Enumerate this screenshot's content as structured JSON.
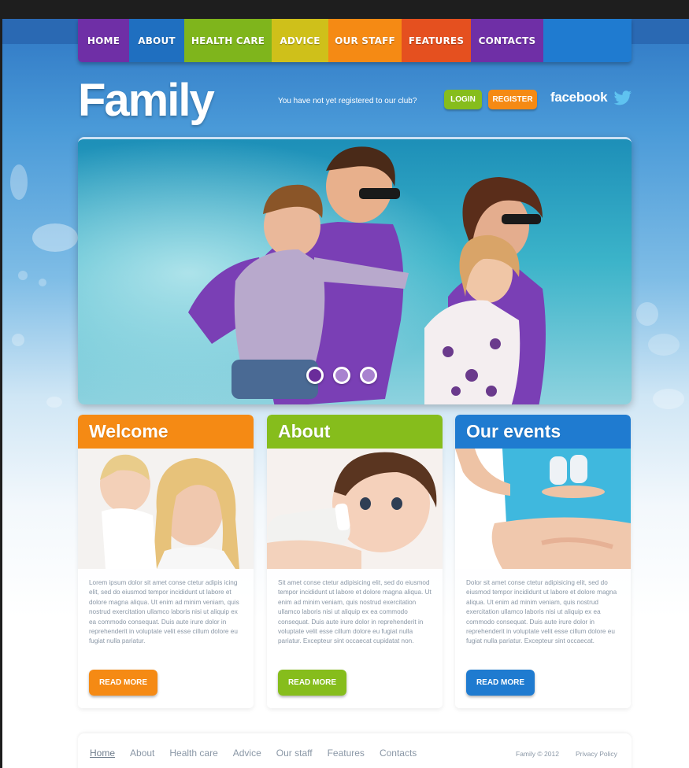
{
  "nav": {
    "items": [
      {
        "label": "HOME",
        "color": "#6f2fa6"
      },
      {
        "label": "ABOUT",
        "color": "#1f6fc0"
      },
      {
        "label": "HEALTH CARE",
        "color": "#7fb51c"
      },
      {
        "label": "ADVICE",
        "color": "#cfc01a"
      },
      {
        "label": "OUR STAFF",
        "color": "#f58a14"
      },
      {
        "label": "FEATURES",
        "color": "#e5501f"
      },
      {
        "label": "CONTACTS",
        "color": "#6f2fa6"
      },
      {
        "label": "",
        "color": "#1f7bd0"
      }
    ]
  },
  "header": {
    "logo": "Family",
    "register_prompt": "You have not yet registered to our club?",
    "login_label": "LOGIN",
    "register_label": "REGISTER",
    "facebook_label": "facebook",
    "login_color": "#86bd1c",
    "register_color": "#f58a14"
  },
  "slider": {
    "slide_count": 3,
    "active_index": 1
  },
  "columns": [
    {
      "title": "Welcome",
      "color": "#f58a14",
      "text": "Lorem ipsum dolor sit amet conse ctetur adipis icing elit, sed do eiusmod tempor incididunt ut labore et dolore magna aliqua. Ut enim ad minim veniam, quis nostrud exercitation ullamco laboris nisi ut aliquip ex ea commodo consequat. Duis aute irure dolor in reprehenderit in voluptate velit esse cillum dolore eu fugiat nulla pariatur.",
      "button": "READ MORE",
      "image_alt": "mother-and-baby"
    },
    {
      "title": "About",
      "color": "#86bd1c",
      "text": "Sit amet conse ctetur adipisicing elit, sed do eiusmod tempor incididunt ut labore et dolore magna aliqua. Ut enim ad minim veniam, quis nostrud exercitation ullamco laboris nisi ut aliquip ex ea commodo consequat. Duis aute irure dolor in reprehenderit in voluptate velit esse cillum dolore eu fugiat nulla pariatur. Excepteur sint occaecat cupidatat non.",
      "button": "READ MORE",
      "image_alt": "baby-with-bottle"
    },
    {
      "title": "Our events",
      "color": "#1f7bd0",
      "text": "Dolor sit amet conse ctetur adipisicing elit, sed do eiusmod tempor incididunt ut labore et dolore magna aliqua. Ut enim ad minim veniam, quis nostrud exercitation ullamco laboris nisi ut aliquip ex ea commodo consequat. Duis aute irure dolor in reprehenderit in voluptate velit esse cillum dolore eu fugiat nulla pariatur. Excepteur sint occaecat.",
      "button": "READ MORE",
      "image_alt": "pregnant-with-baby-shoes"
    }
  ],
  "footer": {
    "links": [
      "Home",
      "About",
      "Health care",
      "Advice",
      "Our staff",
      "Features",
      "Contacts"
    ],
    "copyright": "Family © 2012",
    "privacy": "Privacy Policy"
  }
}
